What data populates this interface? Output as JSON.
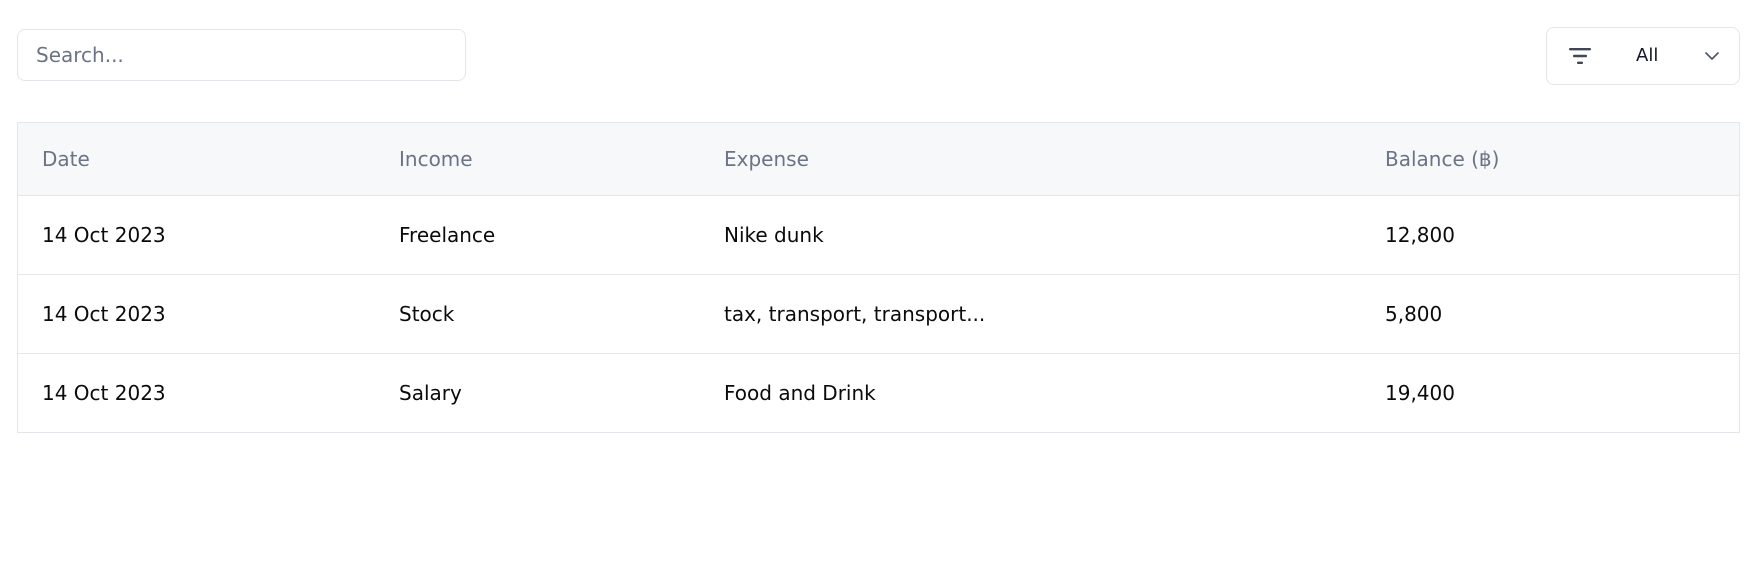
{
  "search": {
    "placeholder": "Search...",
    "value": ""
  },
  "filter": {
    "icon": "filter-icon",
    "selected": "All",
    "chevron_icon": "chevron-down-icon"
  },
  "table": {
    "columns": [
      "Date",
      "Income",
      "Expense",
      "Balance (฿)"
    ],
    "rows": [
      [
        "14 Oct 2023",
        "Freelance",
        "Nike dunk",
        "12,800"
      ],
      [
        "14 Oct 2023",
        "Stock",
        "tax, transport, transport...",
        "5,800"
      ],
      [
        "14 Oct 2023",
        "Salary",
        "Food and Drink",
        "19,400"
      ]
    ]
  },
  "colors": {
    "border": "#e3e6ea",
    "header_bg": "#f7f8fa",
    "header_text": "#6b7486",
    "body_text": "#0b0b0b"
  }
}
